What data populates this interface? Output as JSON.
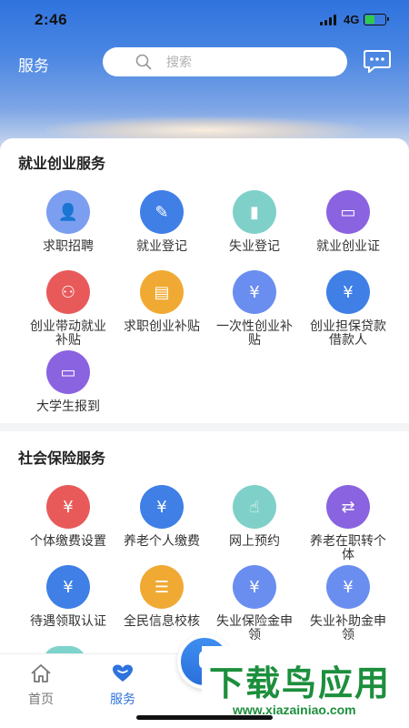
{
  "status": {
    "time": "2:46",
    "network": "4G"
  },
  "header": {
    "title": "服务",
    "search_placeholder": "搜索"
  },
  "sections": [
    {
      "title": "就业创业服务",
      "items": [
        {
          "label": "求职招聘",
          "icon": "job-search-icon",
          "color": "#7b9ef0"
        },
        {
          "label": "就业登记",
          "icon": "edit-document-icon",
          "color": "#3f7fe6"
        },
        {
          "label": "失业登记",
          "icon": "book-icon",
          "color": "#7fd0c8"
        },
        {
          "label": "就业创业证",
          "icon": "id-card-icon",
          "color": "#8a63e0"
        },
        {
          "label": "创业带动就业补贴",
          "icon": "people-subsidy-icon",
          "color": "#e85a5a"
        },
        {
          "label": "求职创业补贴",
          "icon": "wallet-icon",
          "color": "#f0aa33"
        },
        {
          "label": "一次性创业补贴",
          "icon": "money-card-icon",
          "color": "#6a8ef0"
        },
        {
          "label": "创业担保贷款借款人",
          "icon": "loan-briefcase-icon",
          "color": "#3f7fe6"
        },
        {
          "label": "大学生报到",
          "icon": "student-card-icon",
          "color": "#8a63e0"
        }
      ]
    },
    {
      "title": "社会保险服务",
      "items": [
        {
          "label": "个体缴费设置",
          "icon": "payment-card-icon",
          "color": "#e85a5a"
        },
        {
          "label": "养老个人缴费",
          "icon": "pension-pay-icon",
          "color": "#3f7fe6"
        },
        {
          "label": "网上预约",
          "icon": "appointment-icon",
          "color": "#7fd0c8"
        },
        {
          "label": "养老在职转个体",
          "icon": "transfer-icon",
          "color": "#8a63e0"
        },
        {
          "label": "待遇领取认证",
          "icon": "benefit-verify-icon",
          "color": "#3f7fe6"
        },
        {
          "label": "全民信息校核",
          "icon": "info-check-icon",
          "color": "#f0aa33"
        },
        {
          "label": "失业保险金申领",
          "icon": "unemployment-insurance-icon",
          "color": "#6a8ef0"
        },
        {
          "label": "失业补助金申领",
          "icon": "subsidy-claim-icon",
          "color": "#6a8ef0"
        }
      ]
    }
  ],
  "tabs": [
    {
      "label": "首页",
      "icon": "home-icon",
      "active": false
    },
    {
      "label": "服务",
      "icon": "heart-icon",
      "active": true
    }
  ],
  "colors": {
    "accent": "#2f73de",
    "tab_inactive": "#777777",
    "tab_active": "#2f73de"
  },
  "watermark": {
    "big": "下载鸟应用",
    "small": "www.xiazainiao.com"
  }
}
